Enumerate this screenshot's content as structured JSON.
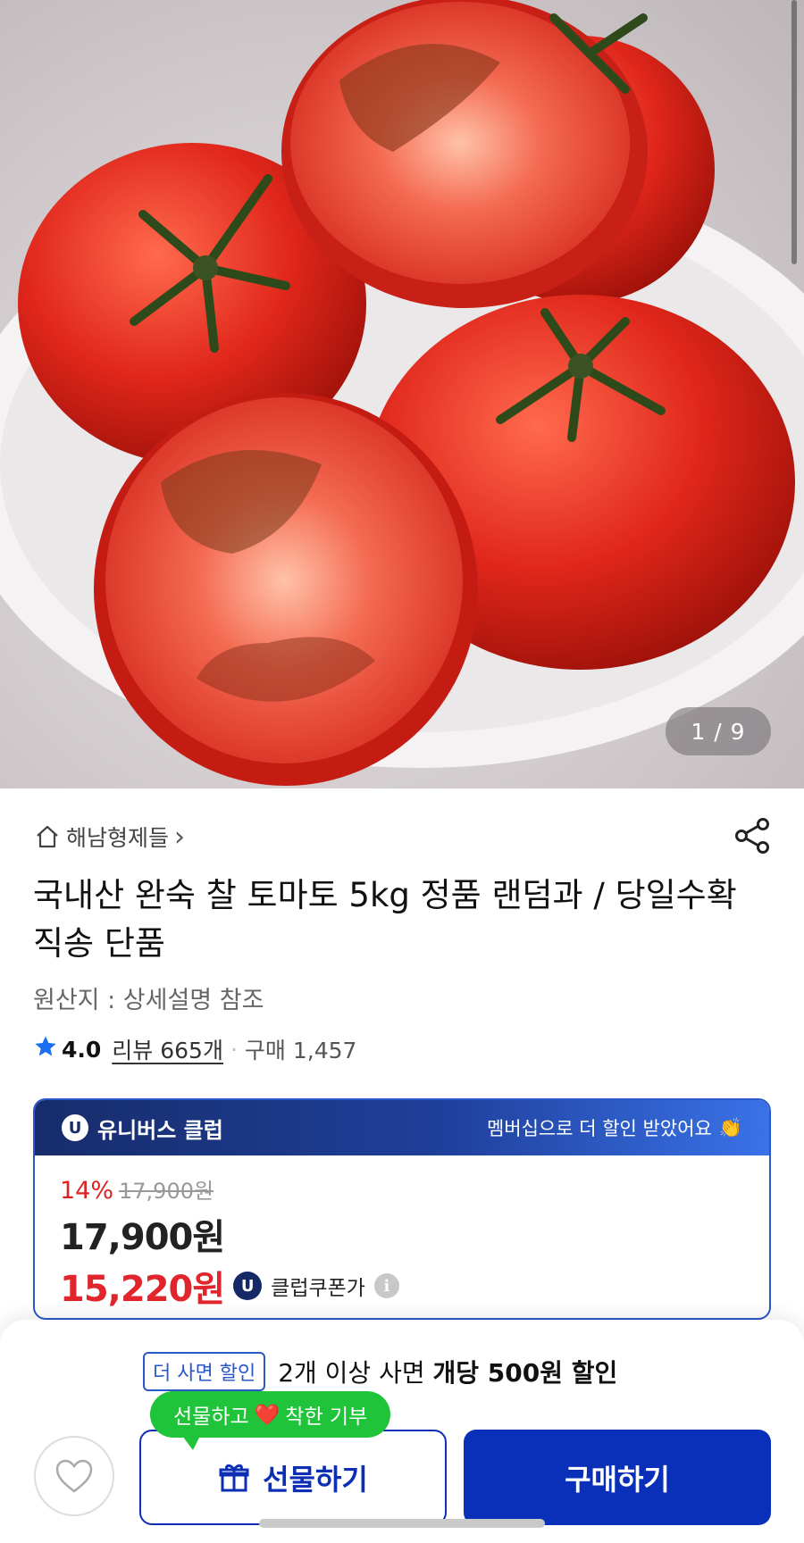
{
  "gallery": {
    "counter": "1 / 9"
  },
  "store": {
    "name": "해남형제들",
    "chevron": "›"
  },
  "product": {
    "title": "국내산 완숙 찰 토마토 5kg 정품 랜덤과 / 당일수확직송 단품",
    "origin": "원산지 : 상세설명 참조",
    "rating": "4.0",
    "reviews": "리뷰 665개",
    "separator": "·",
    "purchases": "구매 1,457"
  },
  "club": {
    "badge": "U",
    "name": "유니버스 클럽",
    "message": "멤버십으로 더 할인 받았어요",
    "message_emoji": "👏",
    "discount_rate": "14%",
    "original_price": "17,900원",
    "price": "17,900원",
    "coupon_price": "15,220원",
    "coupon_label": "클럽쿠폰가",
    "info_icon": "i"
  },
  "bottom": {
    "promo_tag": "더 사면 할인",
    "promo_text_prefix": "2개 이상 사면 ",
    "promo_text_bold": "개당 500원 할인",
    "bubble_left": "선물하고",
    "bubble_heart": "❤️",
    "bubble_right": "착한 기부",
    "gift_label": "선물하기",
    "buy_label": "구매하기"
  },
  "colors": {
    "accent": "#0a2fb8",
    "sale": "#e0262c",
    "green": "#1fc43a"
  }
}
